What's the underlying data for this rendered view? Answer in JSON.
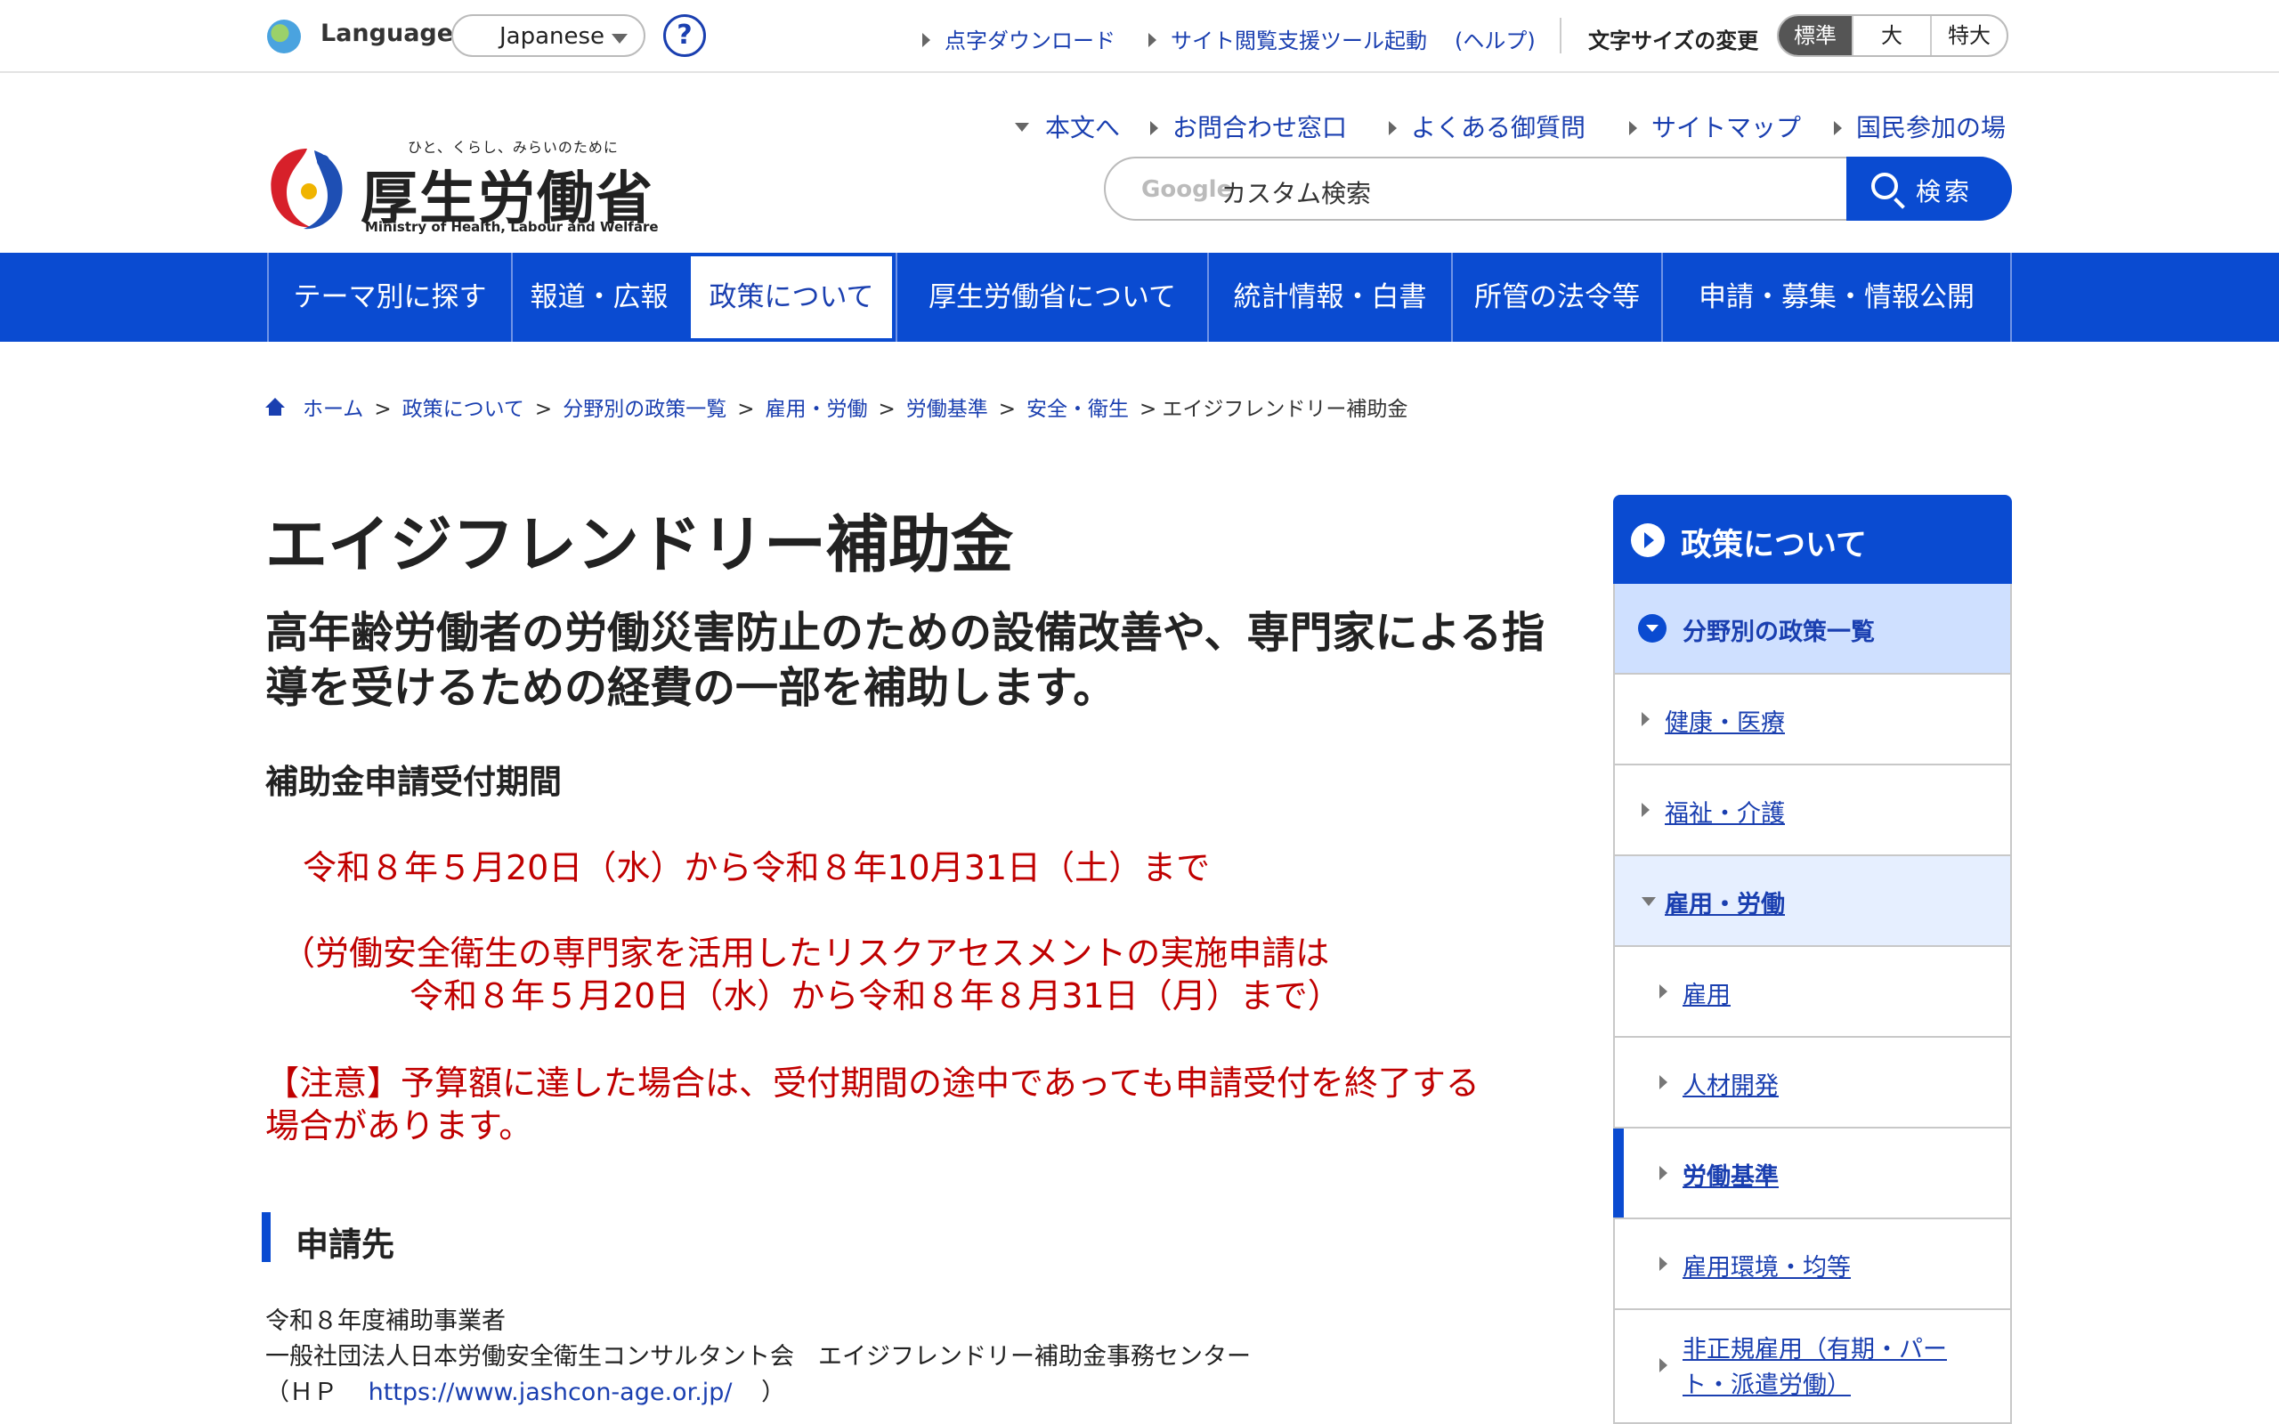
{
  "utility": {
    "language_label": "Language",
    "language_value": "Japanese",
    "help": "?",
    "links": [
      "点字ダウンロード",
      "サイト閲覧支援ツール起動",
      "(ヘルプ)"
    ],
    "font_size_label": "文字サイズの変更",
    "font_sizes": [
      "標準",
      "大",
      "特大"
    ]
  },
  "header": {
    "logo_tagline": "ひと、くらし、みらいのために",
    "logo_name": "厚生労働省",
    "logo_en": "Ministry of Health, Labour and Welfare",
    "links": [
      "本文へ",
      "お問合わせ窓口",
      "よくある御質問",
      "サイトマップ",
      "国民参加の場"
    ],
    "search_brand": "Google",
    "search_placeholder": "カスタム検索",
    "search_button": "検索"
  },
  "gnav": [
    "テーマ別に探す",
    "報道・広報",
    "政策について",
    "厚生労働省について",
    "統計情報・白書",
    "所管の法令等",
    "申請・募集・情報公開"
  ],
  "breadcrumb": [
    "ホーム",
    "政策について",
    "分野別の政策一覧",
    "雇用・労働",
    "労働基準",
    "安全・衛生",
    "エイジフレンドリー補助金"
  ],
  "main": {
    "title": "エイジフレンドリー補助金",
    "lead": "高年齢労働者の労働災害防止のための設備改善や、専門家による指導を受けるための経費の一部を補助します。",
    "period_heading": "補助金申請受付期間",
    "period_main": "令和８年５月20日（水）から令和８年10月31日（土）まで",
    "period_note_1": "（労働安全衛生の専門家を活用したリスクアセスメントの実施申請は",
    "period_note_2": "令和８年５月20日（水）から令和８年８月31日（月）まで）",
    "caution_1": "【注意】予算額に達した場合は、受付期間の途中であっても申請受付を終了する",
    "caution_2": "場合があります。",
    "apply_heading": "申請先",
    "apply_line1": "令和８年度補助事業者",
    "apply_line2": "一般社団法人日本労働安全衛生コンサルタント会　エイジフレンドリー補助金事務センター",
    "apply_hp_prefix": "（ＨＰ",
    "apply_hp_url": "https://www.jashcon-age.or.jp/",
    "apply_hp_suffix": "）"
  },
  "sidebar": {
    "heading": "政策について",
    "items": [
      {
        "label": "分野別の政策一覧"
      },
      {
        "label": "健康・医療"
      },
      {
        "label": "福祉・介護"
      },
      {
        "label": "雇用・労働"
      },
      {
        "label": "雇用"
      },
      {
        "label": "人材開発"
      },
      {
        "label": "労働基準"
      },
      {
        "label": "雇用環境・均等"
      },
      {
        "label": "非正規雇用（有期・パー"
      },
      {
        "label": "ト・派遣労働）"
      }
    ]
  }
}
